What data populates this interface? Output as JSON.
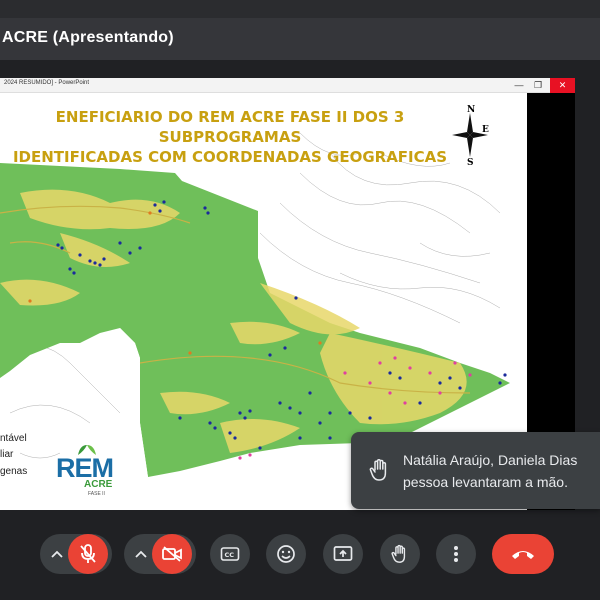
{
  "window": {
    "title": "ACRE (Apresentando)"
  },
  "powerpoint": {
    "title": "2024 RESUMIDO] - PowerPoint",
    "controls": [
      "minimize-icon",
      "maximize-icon",
      "close-icon"
    ]
  },
  "slide": {
    "title_line1": "ENEFICIARIO DO REM ACRE FASE II DOS 3 SUBPROGRAMAS",
    "title_line2": "IDENTIFICADAS COM COORDENADAS GEOGRAFICAS",
    "compass": {
      "n": "N",
      "e": "E",
      "s": "S"
    },
    "legend": [
      "ntável",
      "liar",
      "genas"
    ],
    "logo": {
      "rem": "REM",
      "acre": "ACRE",
      "fase": "FASE II"
    },
    "colors": {
      "title": "#c8a010",
      "land": "#6fbf5a",
      "cleared": "#e8d86a",
      "points_blue": "#1b2a9c",
      "points_pink": "#e040a0",
      "rivers": "#555555"
    }
  },
  "notification": {
    "line1": "Natália Araújo, Daniela Dias",
    "line2": "pessoa levantaram a mão.",
    "icon": "hand-raised-icon"
  },
  "toolbar": {
    "buttons": [
      {
        "name": "mic-options-chevron",
        "icon": "chevron-up-icon"
      },
      {
        "name": "microphone-button",
        "icon": "mic-off-icon",
        "state": "off"
      },
      {
        "name": "camera-options-chevron",
        "icon": "chevron-up-icon"
      },
      {
        "name": "camera-button",
        "icon": "camera-off-icon",
        "state": "off"
      },
      {
        "name": "captions-button",
        "icon": "cc-icon"
      },
      {
        "name": "reactions-button",
        "icon": "emoji-icon"
      },
      {
        "name": "present-button",
        "icon": "present-icon"
      },
      {
        "name": "raise-hand-button",
        "icon": "hand-icon"
      },
      {
        "name": "more-options-button",
        "icon": "more-vert-icon"
      },
      {
        "name": "leave-call-button",
        "icon": "call-end-icon"
      }
    ],
    "colors": {
      "danger": "#ea4335",
      "surface": "#3c4043"
    }
  }
}
